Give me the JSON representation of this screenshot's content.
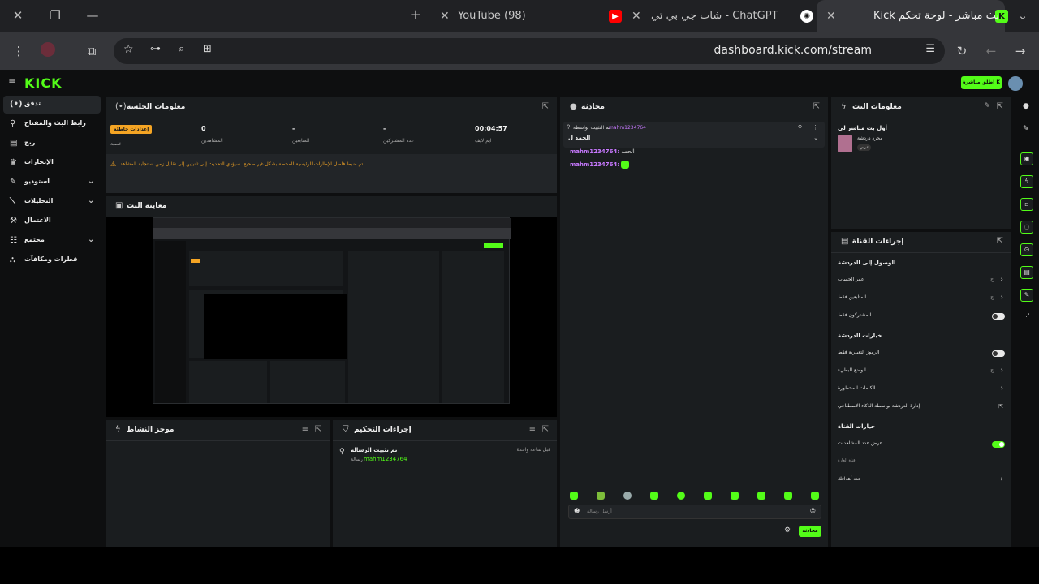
{
  "browser": {
    "tabs": [
      {
        "title": "بث مباشر - لوحة تحكم Kick",
        "favicon": "kick-icon",
        "active": true
      },
      {
        "title": "ChatGPT - شات جي بي تي",
        "favicon": "chatgpt-icon",
        "active": false
      },
      {
        "title": "(98) YouTube",
        "favicon": "youtube-icon",
        "active": false
      }
    ],
    "url": "dashboard.kick.com/stream"
  },
  "kick": {
    "logo": "KICK",
    "go_live_label": "اطلق مباشرة",
    "sidebar": [
      {
        "label": "تدفق",
        "active": true,
        "icon": "stream-icon"
      },
      {
        "label": "رابط البث والمفتاح",
        "icon": "key-icon"
      },
      {
        "label": "ربح",
        "icon": "money-icon"
      },
      {
        "label": "الإنجازات",
        "icon": "trophy-icon"
      },
      {
        "label": "استوديو",
        "icon": "studio-icon",
        "expandable": true
      },
      {
        "label": "التحليلات",
        "icon": "analytics-icon",
        "expandable": true
      },
      {
        "label": "الاعتمال",
        "icon": "moderation-icon"
      },
      {
        "label": "مجتمع",
        "icon": "community-icon",
        "expandable": true
      },
      {
        "label": "قطرات ومكافآت",
        "icon": "drops-icon"
      }
    ]
  },
  "session": {
    "title": "معلومات الجلسة",
    "stats": [
      {
        "value": "00:04:57",
        "label": "ايم لايف"
      },
      {
        "value": "-",
        "label": "عدد المشتركين"
      },
      {
        "value": "-",
        "label": "المتابعين"
      },
      {
        "value": "0",
        "label": "المشاهدين"
      }
    ],
    "badge": "إعدادات خاطئة",
    "badge_label": "خصبة",
    "warning": "تم ضبط فاصل الإطارات الرئيسية للمحطة بشكل غير صحيح. سيؤدي التحديث إلى ثانيتين إلى تقليل زمن استجابة المشاهد."
  },
  "preview": {
    "title": "معاينة البث"
  },
  "activity": {
    "title": "موجز النشاط"
  },
  "mod_actions": {
    "title": "إجراءات التحكيم",
    "item_title": "تم تثبيت الرسالة",
    "item_user": "mahm1234764",
    "item_suffix": "رسالة",
    "item_time": "قبل ساعة واحدة"
  },
  "chat": {
    "title": "محادثة",
    "pinned_by": "تم التثبيت بواسطة",
    "pinned_user": "mahm1234764",
    "pinned_text": "الحمد ل",
    "messages": [
      {
        "user": "mahm1234764:",
        "text": "الحمد"
      },
      {
        "user": "mahm1234764:",
        "text": ""
      }
    ],
    "input_placeholder": "أرسل رسالة",
    "send_label": "محادثة"
  },
  "stream_info": {
    "title": "معلومات البث",
    "stream_title": "أول بث مباشر لي",
    "category": "مجرد دردشة",
    "tag": "عربي"
  },
  "channel_actions": {
    "title": "إجراءات القناة",
    "sections": [
      {
        "heading": "الوصول إلى الدردشة",
        "rows": [
          {
            "label": "عمر الحساب",
            "value": "ح",
            "type": "chevron"
          },
          {
            "label": "المتابعين فقط",
            "value": "ح",
            "type": "chevron"
          },
          {
            "label": "المشتركون فقط",
            "type": "toggle",
            "on": false
          }
        ]
      },
      {
        "heading": "خيارات الدردشة",
        "rows": [
          {
            "label": "الرموز التعبيرية فقط",
            "type": "toggle",
            "on": false
          },
          {
            "label": "الوضع البطيء",
            "value": "ح",
            "type": "chevron"
          },
          {
            "label": "الكلمات المحظورة",
            "type": "chevron"
          },
          {
            "label": "إدارة الدردشة بواسطة الذكاء الاصطناعي",
            "type": "external"
          }
        ]
      },
      {
        "heading": "خيارات القناة",
        "rows": [
          {
            "label": "عرض عدد المشاهدات",
            "type": "toggle",
            "on": true
          },
          {
            "label": "قناة الغارة",
            "type": "text"
          },
          {
            "label": "حدد أهدافك",
            "type": "chevron"
          }
        ]
      }
    ]
  },
  "colors": {
    "kick_green": "#53fc18",
    "panel": "#1a1d1f",
    "bg": "#0e0f10",
    "warning": "#f5a524",
    "username": "#c879ff"
  }
}
